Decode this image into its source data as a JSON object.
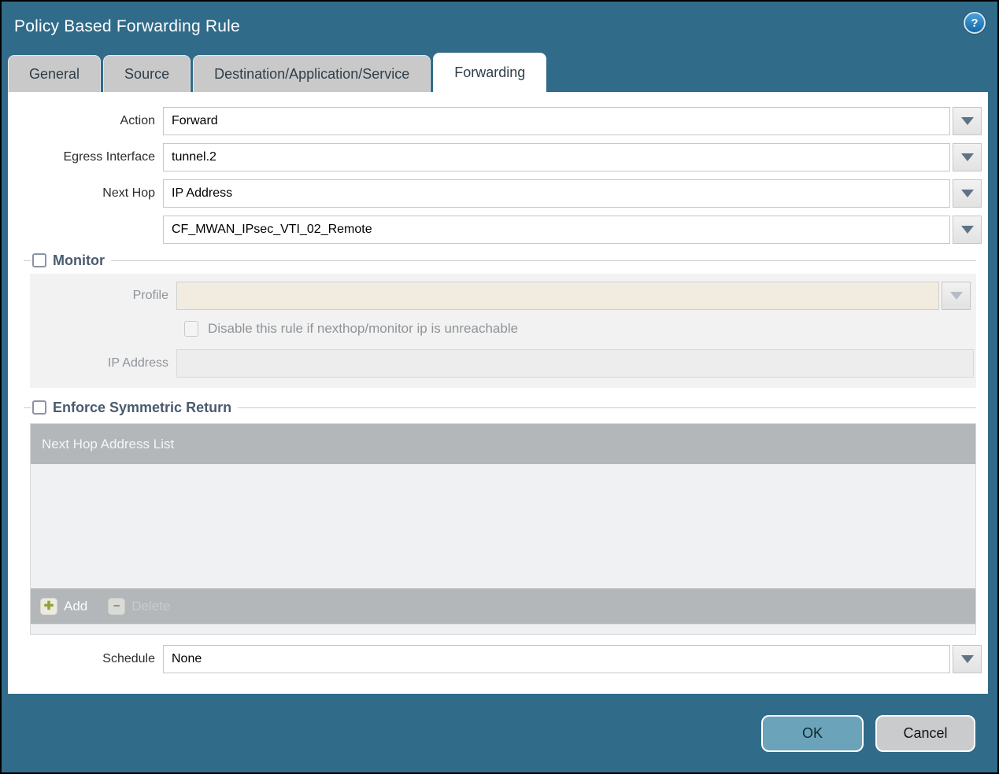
{
  "colors": {
    "teal": "#316b8a",
    "tab-gray": "#c9c9c9",
    "group-title": "#4a5b6e",
    "beige": "#f1ecdf",
    "bar-gray": "#b3b7ba",
    "add-green": "#93a33b",
    "del-red": "#a0706e",
    "ok-blue": "#6ba4ba",
    "cancel-gray": "#c9cbcd"
  },
  "icons": {
    "help": "?",
    "add": "✚",
    "delete": "−",
    "dropdown": "triangle-down"
  },
  "window": {
    "title": "Policy Based Forwarding Rule"
  },
  "tabs": [
    {
      "label": "General",
      "active": false
    },
    {
      "label": "Source",
      "active": false
    },
    {
      "label": "Destination/Application/Service",
      "active": false
    },
    {
      "label": "Forwarding",
      "active": true
    }
  ],
  "form": {
    "action": {
      "label": "Action",
      "value": "Forward"
    },
    "egress_interface": {
      "label": "Egress Interface",
      "value": "tunnel.2"
    },
    "next_hop": {
      "label": "Next Hop",
      "value": "IP Address"
    },
    "next_hop_address": {
      "value": "CF_MWAN_IPsec_VTI_02_Remote"
    },
    "monitor": {
      "label": "Monitor",
      "checked": false,
      "profile": {
        "label": "Profile",
        "value": ""
      },
      "disable_rule": {
        "label": "Disable this rule if nexthop/monitor ip is unreachable",
        "checked": false
      },
      "ip_address": {
        "label": "IP Address",
        "value": ""
      }
    },
    "enforce_symmetric_return": {
      "label": "Enforce Symmetric Return",
      "checked": false,
      "table": {
        "header": "Next Hop Address List",
        "rows": []
      },
      "add_label": "Add",
      "delete_label": "Delete"
    },
    "schedule": {
      "label": "Schedule",
      "value": "None"
    }
  },
  "footer": {
    "ok_label": "OK",
    "cancel_label": "Cancel"
  }
}
